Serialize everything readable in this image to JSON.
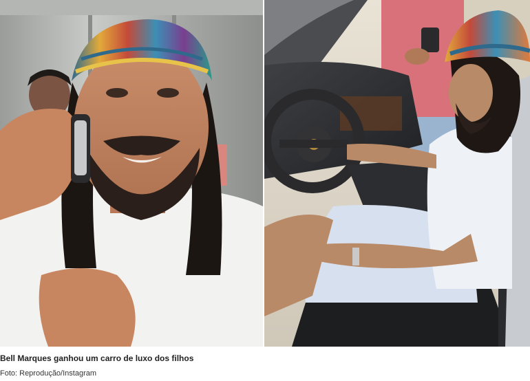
{
  "caption": "Bell Marques ganhou um carro de luxo dos filhos",
  "credit": "Foto: Reprodução/Instagram",
  "colors": {
    "caption_text": "#222222",
    "credit_text": "#333333",
    "background": "#ffffff"
  }
}
